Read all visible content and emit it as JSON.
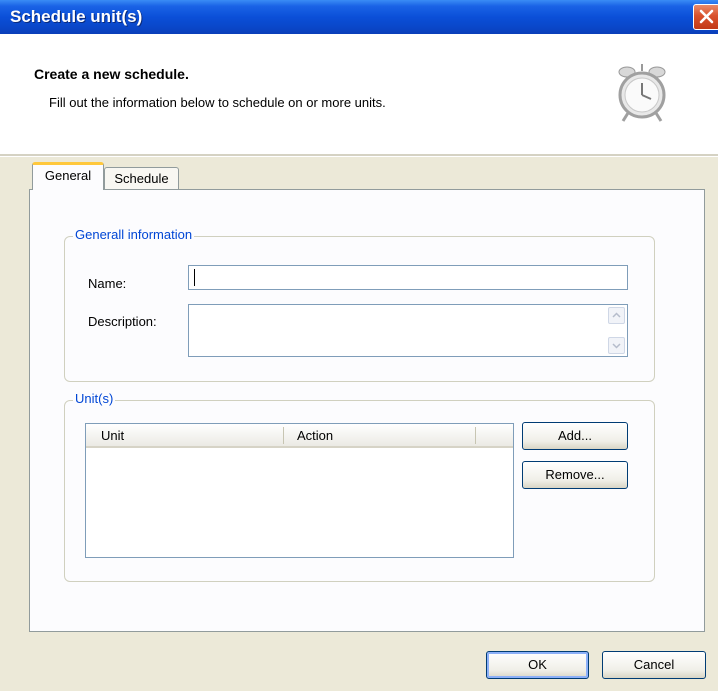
{
  "window": {
    "title": "Schedule unit(s)"
  },
  "header": {
    "title": "Create a new schedule.",
    "subtitle": "Fill out the information below to schedule on or more units."
  },
  "tabs": [
    {
      "label": "General",
      "selected": true
    },
    {
      "label": "Schedule",
      "selected": false
    }
  ],
  "general_info": {
    "legend": "Generall information",
    "name_label": "Name:",
    "name_value": "",
    "description_label": "Description:",
    "description_value": ""
  },
  "units": {
    "legend": "Unit(s)",
    "columns": [
      "Unit",
      "Action"
    ],
    "rows": [],
    "add_label": "Add...",
    "remove_label": "Remove..."
  },
  "footer": {
    "ok_label": "OK",
    "cancel_label": "Cancel"
  },
  "colors": {
    "titlebar": "#0b4fd8",
    "dialog_bg": "#ece9d8",
    "group_legend": "#0046d5",
    "close_button": "#d9512c"
  }
}
